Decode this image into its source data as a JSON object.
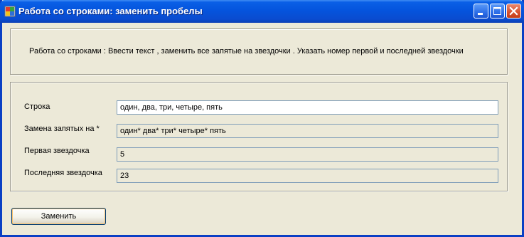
{
  "window": {
    "title": "Работа со строками: заменить пробелы"
  },
  "description": "Работа со строками : Ввести текст , заменить все запятые на звездочки . Указать номер первой и последней звездочки",
  "form": {
    "string_label": "Строка",
    "string_value": "один, два, три, четыре, пять",
    "replace_label": "Замена запятых на *",
    "replace_value": "один* два* три* четыре* пять",
    "first_label": "Первая звездочка",
    "first_value": "5",
    "last_label": "Последняя звездочка",
    "last_value": "23"
  },
  "actions": {
    "replace_button": "Заменить"
  },
  "colors": {
    "titlebar": "#0554dd",
    "window_bg": "#ece9d8",
    "close_button": "#d6512e"
  },
  "icons": [
    "app-icon",
    "minimize-icon",
    "maximize-icon",
    "close-icon"
  ]
}
